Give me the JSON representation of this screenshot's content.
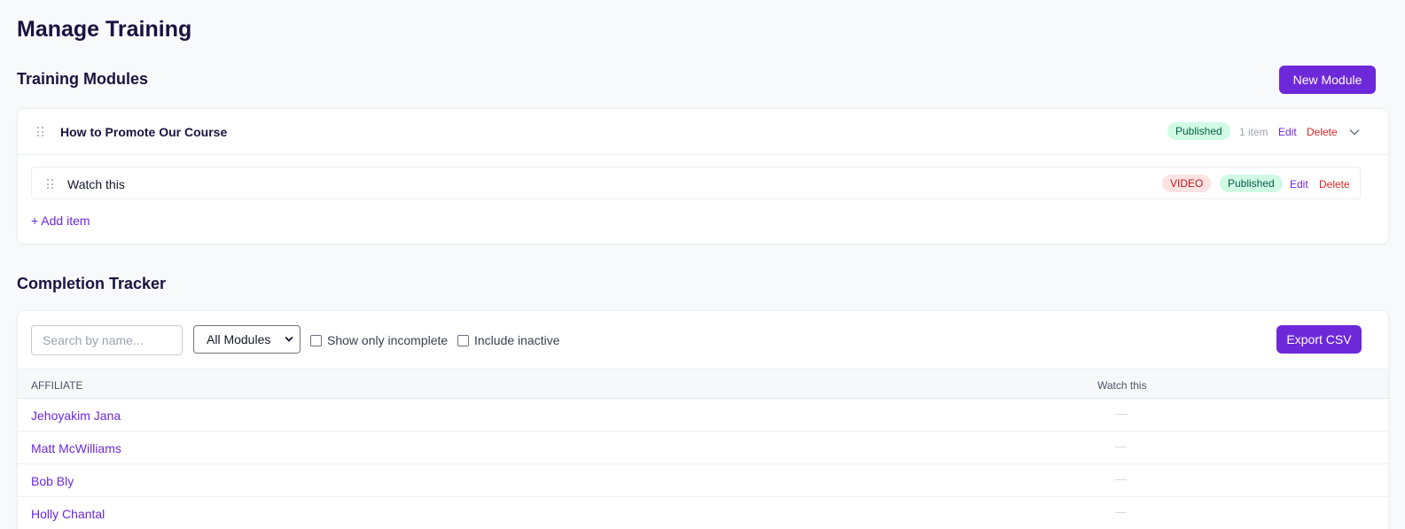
{
  "page": {
    "title": "Manage Training"
  },
  "modules_section": {
    "title": "Training Modules",
    "new_module_label": "New Module",
    "module": {
      "name": "How to Promote Our Course",
      "status": "Published",
      "item_count": "1 item",
      "edit_label": "Edit",
      "delete_label": "Delete",
      "expand_icon": "chevron-down-icon",
      "items": [
        {
          "name": "Watch this",
          "type": "VIDEO",
          "status": "Published",
          "edit_label": "Edit",
          "delete_label": "Delete"
        }
      ],
      "add_item_label": "+ Add item"
    }
  },
  "tracker_section": {
    "title": "Completion Tracker",
    "search": {
      "placeholder": "Search by name...",
      "value": ""
    },
    "module_filter": {
      "selected": "All Modules"
    },
    "show_incomplete": {
      "label": "Show only incomplete",
      "checked": false
    },
    "include_inactive": {
      "label": "Include inactive",
      "checked": false
    },
    "export_label": "Export CSV",
    "columns": [
      "AFFILIATE",
      "Watch this"
    ],
    "rows": [
      {
        "name": "Jehoyakim Jana",
        "watch_this": "—"
      },
      {
        "name": "Matt McWilliams",
        "watch_this": "—"
      },
      {
        "name": "Bob Bly",
        "watch_this": "—"
      },
      {
        "name": "Holly Chantal",
        "watch_this": "—"
      }
    ]
  },
  "colors": {
    "accent": "#6d28d9",
    "published_bg": "#d1fae5",
    "published_text": "#065f46",
    "video_bg": "#fde2e2",
    "video_text": "#b91c1c",
    "delete": "#dc2626",
    "background": "#f8f9fb"
  }
}
